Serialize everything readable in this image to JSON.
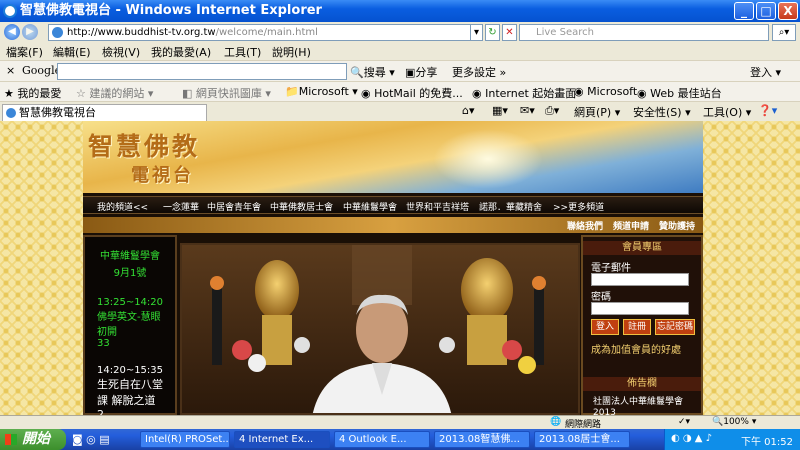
{
  "window": {
    "title": "智慧佛教電視台 - Windows Internet Explorer",
    "minimize": "_",
    "maximize": "□",
    "close": "X"
  },
  "address": {
    "url_host": "http://www.buddhist-tv.org.tw",
    "url_path": "/welcome/main.html",
    "search_placeholder": "Live Search"
  },
  "menu": [
    "檔案(F)",
    "編輯(E)",
    "檢視(V)",
    "我的最愛(A)",
    "工具(T)",
    "說明(H)"
  ],
  "google_bar": {
    "logo": "Google",
    "search_btn": "搜尋",
    "share_btn": "分享",
    "settings_btn": "更多設定 »",
    "signin": "登入"
  },
  "favorites_bar": {
    "favorites": "我的最愛",
    "items": [
      "建議的網站",
      "網頁快訊圖庫",
      "Microsoft",
      "HotMail 的免費...",
      "Internet 起始畫面",
      "Microsoft",
      "Web 最佳站台"
    ]
  },
  "tab": {
    "label": "智慧佛教電視台"
  },
  "command_bar": {
    "page": "網頁(P)",
    "safety": "安全性(S)",
    "tools": "工具(O)"
  },
  "site": {
    "title_main": "智慧佛教",
    "title_sub": "電視台",
    "nav": [
      "我的頻道<<",
      "一念蓮華",
      "中居會青年會",
      "中華佛教居士會",
      "中華維鬘學會",
      "世界和平吉祥塔",
      "諾那．華藏精舍",
      ">>更多頻道"
    ],
    "subnav": [
      "聯絡我們",
      "頻道申請",
      "贊助護持"
    ],
    "left_panel": {
      "channel": "中華維鬘學會",
      "date": "9月1號",
      "schedule": [
        {
          "time": "13:25~14:20",
          "title": "佛學英文-慧眼初開",
          "ep": "33"
        },
        {
          "time": "14:20~15:35",
          "title": "生死自在八堂課 解脫之道 2",
          "ep": ""
        }
      ]
    },
    "member": {
      "header": "會員專區",
      "email_label": "電子郵件",
      "password_label": "密碼",
      "login_btn": "登入",
      "register_btn": "註冊",
      "forgot_btn": "忘記密碼",
      "join_link": "成為加值會員的好處",
      "notice_header": "佈告欄",
      "notice_text": "社團法人中華維鬘學會 2013"
    }
  },
  "statusbar": {
    "zone": "網際網路",
    "zoom": "100%"
  },
  "taskbar": {
    "start": "開始",
    "tasks": [
      "Intel(R) PROSet...",
      "4 Internet Ex...",
      "4 Outlook E...",
      "2013.08智慧佛...",
      "2013.08居士會..."
    ],
    "clock": "下午 01:52"
  }
}
